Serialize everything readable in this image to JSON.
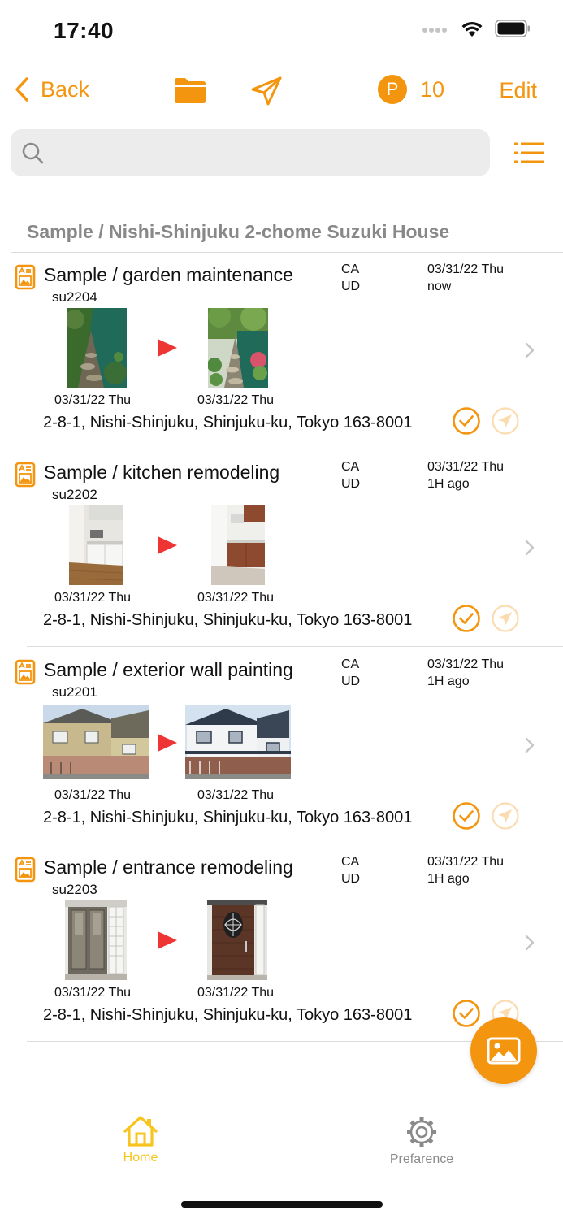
{
  "status_bar": {
    "time": "17:40"
  },
  "nav": {
    "back_label": "Back",
    "points_badge": "P",
    "points_count": "10",
    "edit_label": "Edit"
  },
  "search": {
    "placeholder": ""
  },
  "section_header": "Sample / Nishi-Shinjuku 2-chome Suzuki House",
  "items": [
    {
      "title": "Sample / garden maintenance",
      "code": "su2204",
      "ca": "CA",
      "ud": "UD",
      "date": "03/31/22 Thu",
      "time_ago": "now",
      "before_date": "03/31/22 Thu",
      "after_date": "03/31/22 Thu",
      "address": "2-8-1, Nishi-Shinjuku, Shinjuku-ku, Tokyo 163-8001"
    },
    {
      "title": "Sample / kitchen remodeling",
      "code": "su2202",
      "ca": "CA",
      "ud": "UD",
      "date": "03/31/22 Thu",
      "time_ago": "1H ago",
      "before_date": "03/31/22 Thu",
      "after_date": "03/31/22 Thu",
      "address": "2-8-1, Nishi-Shinjuku, Shinjuku-ku, Tokyo 163-8001"
    },
    {
      "title": "Sample / exterior wall painting",
      "code": "su2201",
      "ca": "CA",
      "ud": "UD",
      "date": "03/31/22 Thu",
      "time_ago": "1H ago",
      "before_date": "03/31/22 Thu",
      "after_date": "03/31/22 Thu",
      "address": "2-8-1, Nishi-Shinjuku, Shinjuku-ku, Tokyo 163-8001"
    },
    {
      "title": "Sample / entrance remodeling",
      "code": "su2203",
      "ca": "CA",
      "ud": "UD",
      "date": "03/31/22 Thu",
      "time_ago": "1H ago",
      "before_date": "03/31/22 Thu",
      "after_date": "03/31/22 Thu",
      "address": "2-8-1, Nishi-Shinjuku, Shinjuku-ku, Tokyo 163-8001"
    }
  ],
  "tabs": [
    {
      "label": "Home",
      "icon": "home-icon",
      "active": true
    },
    {
      "label": "Prefarence",
      "icon": "gear-icon",
      "active": false
    }
  ],
  "colors": {
    "accent": "#f4950f",
    "tab_active": "#f7c51e",
    "tab_inactive": "#8a8a8a",
    "play": "#ef3434"
  }
}
